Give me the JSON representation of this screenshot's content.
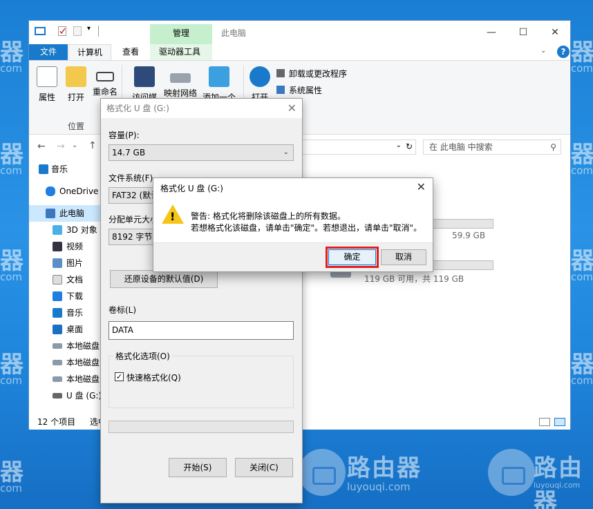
{
  "watermark": {
    "brand": "路由器",
    "site": "luyouqi.com",
    "left_brand": "器",
    "left_site": "com"
  },
  "explorer": {
    "title": "此电脑",
    "manage_label": "管理",
    "tabs": [
      "文件",
      "计算机",
      "查看",
      "驱动器工具"
    ],
    "ribbon_buttons": [
      "属性",
      "打开",
      "重命名",
      "访问媒体",
      "映射网络",
      "添加一个",
      "打开"
    ],
    "ribbon_small": [
      "卸载或更改程序",
      "系统属性"
    ],
    "group_label": "位置",
    "search_placeholder": "在 此电脑 中搜索",
    "nav_items": [
      "音乐",
      "OneDrive",
      "此电脑",
      "3D 对象",
      "视频",
      "图片",
      "文档",
      "下载",
      "音乐",
      "桌面",
      "本地磁盘",
      "本地磁盘",
      "本地磁盘",
      "U 盘 (G:)"
    ],
    "drive1_size": "59.9 GB",
    "drive2_info": "119 GB 可用，共 119 GB",
    "status": "12 个项目",
    "status_extra": "选中"
  },
  "format_dialog": {
    "title": "格式化 U 盘 (G:)",
    "capacity_label": "容量(P):",
    "capacity_value": "14.7 GB",
    "fs_label": "文件系统(F)",
    "fs_value": "FAT32 (默认)",
    "alloc_label": "分配单元大小",
    "alloc_value": "8192 字节",
    "restore_button": "还原设备的默认值(D)",
    "volume_label": "卷标(L)",
    "volume_value": "DATA",
    "options_label": "格式化选项(O)",
    "quick_format": "快速格式化(Q)",
    "start_button": "开始(S)",
    "close_button": "关闭(C)"
  },
  "warning_dialog": {
    "title": "格式化 U 盘 (G:)",
    "line1": "警告: 格式化将删除该磁盘上的所有数据。",
    "line2": "若想格式化该磁盘，请单击\"确定\"。若想退出，请单击\"取消\"。",
    "ok_button": "确定",
    "cancel_button": "取消"
  }
}
